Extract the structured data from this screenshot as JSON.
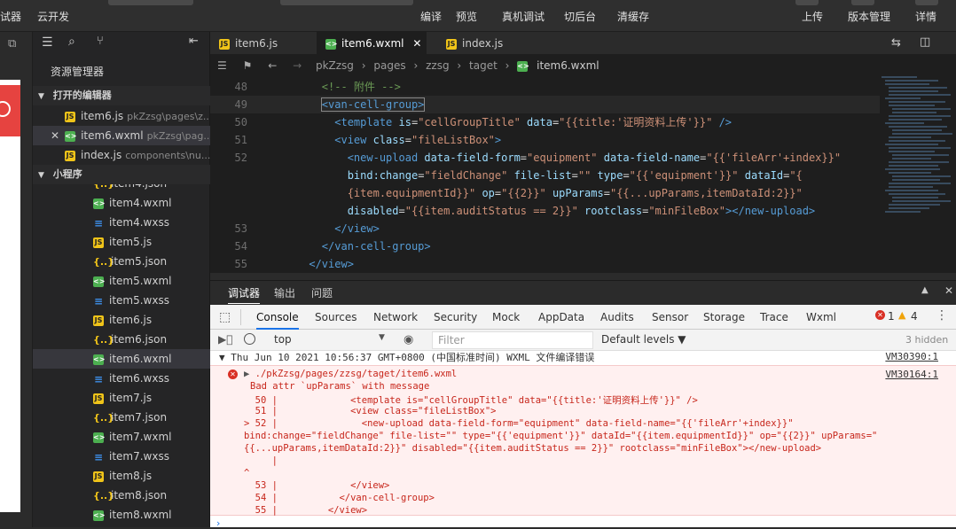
{
  "toolbar": {
    "left_fragment": "试器",
    "cloud_dev": "云开发",
    "compile": "编译",
    "preview": "预览",
    "real_debug": "真机调试",
    "background": "切后台",
    "clear_cache": "清缓存",
    "upload": "上传",
    "version": "版本管理",
    "details": "详情"
  },
  "explorer": {
    "title": "资源管理器",
    "open_editors_header": "打开的编辑器",
    "open_editors": [
      {
        "name": "item6.js",
        "path": "pkZzsg\\pages\\z..."
      },
      {
        "name": "item6.wxml",
        "path": "pkZzsg\\pag..."
      },
      {
        "name": "index.js",
        "path": "components\\nu..."
      }
    ],
    "project_header": "小程序",
    "files": [
      "item4.json",
      "item4.wxml",
      "item4.wxss",
      "item5.js",
      "item5.json",
      "item5.wxml",
      "item5.wxss",
      "item6.js",
      "item6.json",
      "item6.wxml",
      "item6.wxss",
      "item7.js",
      "item7.json",
      "item7.wxml",
      "item7.wxss",
      "item8.js",
      "item8.json",
      "item8.wxml"
    ]
  },
  "editor": {
    "tabs": [
      "item6.js",
      "item6.wxml",
      "index.js"
    ],
    "active_tab": "item6.wxml",
    "breadcrumb": [
      "pkZzsg",
      "pages",
      "zzsg",
      "taget",
      "item6.wxml"
    ],
    "line_numbers": [
      "48",
      "49",
      "50",
      "51",
      "52",
      "",
      "",
      "",
      "53",
      "54",
      "55"
    ]
  },
  "debugger": {
    "panel_tabs": [
      "调试器",
      "输出",
      "问题"
    ],
    "devtools_tabs": [
      "Console",
      "Sources",
      "Network",
      "Security",
      "Mock",
      "AppData",
      "Audits",
      "Sensor",
      "Storage",
      "Trace",
      "Wxml"
    ],
    "error_count": "1",
    "warning_count": "4",
    "context": "top",
    "filter_placeholder": "Filter",
    "levels": "Default levels ▼",
    "hidden": "3 hidden",
    "log_header": "Thu Jun 10 2021 10:56:37 GMT+0800 (中国标准时间) WXML 文件编译错误",
    "log_header_link": "VM30390:1",
    "error_path": "./pkZzsg/pages/zzsg/taget/item6.wxml",
    "error_link": "VM30164:1",
    "error_msg": "Bad attr `upParams` with message",
    "error_lines": [
      "  50 |             <template is=\"cellGroupTitle\" data=\"{{title:'证明资料上传'}}\" />",
      "  51 |             <view class=\"fileListBox\">",
      "> 52 |               <new-upload data-field-form=\"equipment\" data-field-name=\"{{'fileArr'+index}}\"",
      "bind:change=\"fieldChange\" file-list=\"\" type=\"{{'equipment'}}\" dataId=\"{{item.equipmentId}}\" op=\"{{2}}\" upParams=\"",
      "{{...upParams,itemDataId:2}}\" disabled=\"{{item.auditStatus == 2}}\" rootclass=\"minFileBox\"></new-upload>",
      "     |",
      "^",
      "  53 |             </view>",
      "  54 |           </van-cell-group>",
      "  55 |         </view>"
    ]
  },
  "colors": {
    "editor_bg": "#1e1e1e",
    "sidebar_bg": "#252526",
    "error_red": "#c7261b",
    "error_bg": "#fff0f0",
    "warning": "#f0a30a"
  }
}
